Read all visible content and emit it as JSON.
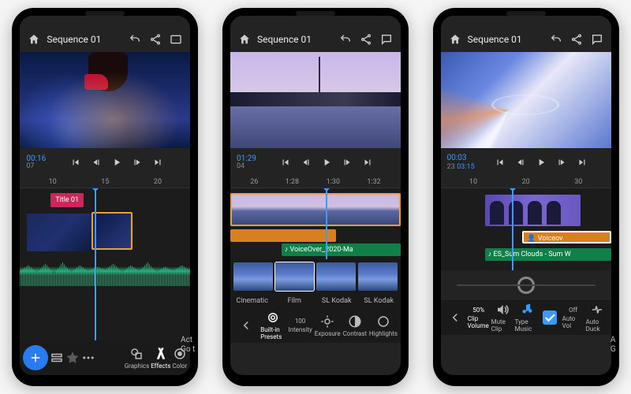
{
  "phones": [
    {
      "title": "Sequence 01",
      "timecode": "00:16",
      "subframe": "07",
      "ruler": [
        "10",
        "15",
        "20"
      ],
      "titleClip": "Title 01",
      "playhead_pct": 44,
      "bottom": [
        {
          "icon": "plus",
          "label": ""
        },
        {
          "icon": "layers",
          "label": ""
        },
        {
          "icon": "marker",
          "label": ""
        },
        {
          "icon": "ellipsis",
          "label": ""
        },
        {
          "icon": "spacer",
          "label": ""
        },
        {
          "icon": "graphics",
          "label": "Graphics"
        },
        {
          "icon": "effects",
          "label": "Effects"
        },
        {
          "icon": "color",
          "label": "Color"
        }
      ]
    },
    {
      "title": "Sequence 01",
      "timecode": "01:29",
      "subframe": "04",
      "ruler": [
        "26",
        "1:28",
        "1:30",
        "1:32"
      ],
      "voiceover": "VoiceOver_2020-Ma",
      "sliders": [
        {
          "label": "Built-in Presets",
          "val": ""
        },
        {
          "label": "Intensity",
          "val": "100"
        },
        {
          "label": "Exposure",
          "val": ""
        },
        {
          "label": "Contrast",
          "val": ""
        },
        {
          "label": "Highlights",
          "val": ""
        }
      ],
      "thumbs": [
        "Cinematic",
        "Film",
        "SL Kodak",
        "SL Kodak"
      ],
      "playhead_pct": 56
    },
    {
      "title": "Sequence 01",
      "timecode": "00:03",
      "subframe": "23",
      "duration": "03:15",
      "ruler": [
        "10",
        "20",
        "30"
      ],
      "voiceover": "Voiceov",
      "music": "ES_Sum Clouds - Sum W",
      "playhead_pct": 42,
      "bottom": [
        {
          "label": "Clip Volume",
          "val": "50%"
        },
        {
          "label": "Mute Clip",
          "icon": "speaker"
        },
        {
          "label": "Type Music",
          "icon": "note"
        },
        {
          "label": "",
          "icon": "check"
        },
        {
          "label": "Auto Vol",
          "val": "Off"
        },
        {
          "label": "Auto Duck",
          "icon": "duck"
        }
      ]
    }
  ],
  "watermark": {
    "line1": "Act",
    "line2": "Go t"
  },
  "watermark3": {
    "line1": "A",
    "line2": "G"
  }
}
